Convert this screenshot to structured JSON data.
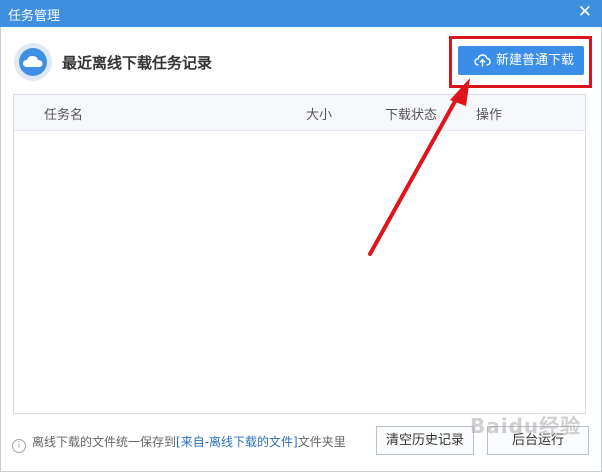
{
  "window": {
    "title": "任务管理",
    "close_glyph": "✕"
  },
  "header": {
    "title": "最近离线下载任务记录",
    "icon": "cloud-icon"
  },
  "actions": {
    "new_download_label": "新建普通下载",
    "new_download_icon": "cloud-upload-icon"
  },
  "table": {
    "columns": [
      "任务名",
      "大小",
      "下载状态",
      "操作"
    ],
    "rows": []
  },
  "footer": {
    "info_prefix": "离线下载的文件统一保存到",
    "info_link": "[来自-离线下载的文件]",
    "info_suffix": "文件夹里",
    "clear_history_label": "清空历史记录",
    "background_run_label": "后台运行"
  },
  "watermark": {
    "text": "Baidu经验"
  },
  "colors": {
    "titlebar": "#3d8fe0",
    "primary_button": "#3b8ee8",
    "highlight": "#d9141b"
  }
}
